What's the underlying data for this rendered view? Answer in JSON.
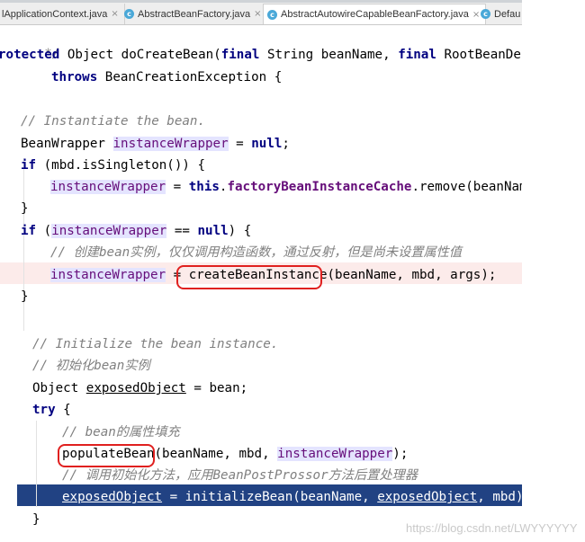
{
  "tabs": [
    {
      "label": "lApplicationContext.java",
      "close": "×",
      "icon": ""
    },
    {
      "label": "AbstractBeanFactory.java",
      "close": "×",
      "icon": "c"
    },
    {
      "label": "AbstractAutowireCapableBeanFactory.java",
      "close": "×",
      "icon": "c"
    },
    {
      "label": "Defau",
      "close": "",
      "icon": "c"
    }
  ],
  "code": {
    "l0": {
      "a": "*/"
    },
    "l1": {
      "a": "rotected",
      "b": " Object doCreateBean(",
      "c": "final",
      "d": " String beanName, ",
      "e": "final",
      "f": " RootBeanDefin"
    },
    "l2": {
      "a": "throws",
      "b": " BeanCreationException {"
    },
    "l3": {
      "a": "// Instantiate the bean."
    },
    "l4": {
      "a": "BeanWrapper ",
      "b": "instanceWrapper",
      "c": " = ",
      "d": "null",
      "e": ";"
    },
    "l5": {
      "a": "if",
      "b": " (mbd.isSingleton()) {"
    },
    "l6": {
      "a": "instanceWrapper",
      "b": " = ",
      "c": "this",
      "d": ".",
      "e": "factoryBeanInstanceCache",
      "f": ".remove(beanName)"
    },
    "l7": {
      "a": "}"
    },
    "l8": {
      "a": "if",
      "b": " (",
      "c": "instanceWrapper",
      "d": " == ",
      "e": "null",
      "f": ") {"
    },
    "l9": {
      "a": "// 创建bean实例，仅仅调用构造函数，通过反射，但是尚未设置属性值"
    },
    "l10": {
      "a": "instanceWrapper",
      "b": " = ",
      "c": "createBeanInstance",
      "d": "(beanName, mbd, args);"
    },
    "l11": {
      "a": "}"
    },
    "l12": {
      "a": "// Initialize the bean instance."
    },
    "l13": {
      "a": "// 初始化bean实例"
    },
    "l14": {
      "a": "Object ",
      "b": "exposedObject",
      "c": " = bean;"
    },
    "l15": {
      "a": "try",
      "b": " {"
    },
    "l16": {
      "a": "// bean的属性填充"
    },
    "l17": {
      "a": "populateBean",
      "b": "(beanName, mbd, ",
      "c": "instanceWrapper",
      "d": ");"
    },
    "l18": {
      "a": "// 调用初始化方法，应用BeanPostProssor方法后置处理器"
    },
    "l19": {
      "a": "exposedObject",
      "b": " = initializeBean(beanName, ",
      "c": "exposedObject",
      "d": ", mbd);"
    },
    "l20": {
      "a": "}"
    }
  },
  "colors": {
    "keyword": "#000080",
    "comment": "#808080",
    "field": "#660e7a",
    "caret_row": "#fcebea",
    "selection": "#214283",
    "var_highlight": "#e4e4ff",
    "annotation_box": "#e0201f"
  },
  "watermark": "https://blog.csdn.net/LWYYYYYY"
}
